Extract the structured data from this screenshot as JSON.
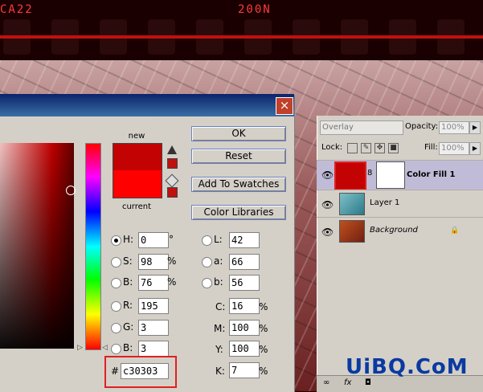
{
  "background": {
    "film_text_left": "CA22",
    "film_text_right": "200N"
  },
  "picker": {
    "close_label": "×",
    "new_label": "new",
    "current_label": "current",
    "new_color": "#c30303",
    "current_color": "#ff0000",
    "buttons": {
      "ok": "OK",
      "reset": "Reset",
      "add_swatches": "Add To Swatches",
      "color_libraries": "Color Libraries"
    },
    "hsb": {
      "h_label": "H:",
      "h_value": "0",
      "h_unit": "°",
      "s_label": "S:",
      "s_value": "98",
      "s_unit": "%",
      "b_label": "B:",
      "b_value": "76",
      "b_unit": "%"
    },
    "rgb": {
      "r_label": "R:",
      "r_value": "195",
      "g_label": "G:",
      "g_value": "3",
      "b_label": "B:",
      "b_value": "3"
    },
    "lab": {
      "l_label": "L:",
      "l_value": "42",
      "a_label": "a:",
      "a_value": "66",
      "b_label": "b:",
      "b_value": "56"
    },
    "cmyk": {
      "c_label": "C:",
      "c_value": "16",
      "c_unit": "%",
      "m_label": "M:",
      "m_value": "100",
      "m_unit": "%",
      "y_label": "Y:",
      "y_value": "100",
      "y_unit": "%",
      "k_label": "K:",
      "k_value": "7",
      "k_unit": "%"
    },
    "hex_label": "#",
    "hex_value": "c30303"
  },
  "layers": {
    "blend_mode": "Overlay",
    "opacity_label": "Opacity:",
    "opacity_value": "100%",
    "lock_label": "Lock:",
    "fill_label": "Fill:",
    "fill_value": "100%",
    "rows": [
      {
        "name": "Color Fill 1"
      },
      {
        "name": "Layer 1"
      },
      {
        "name": "Background"
      }
    ]
  },
  "watermark": "UiBQ.CoM"
}
